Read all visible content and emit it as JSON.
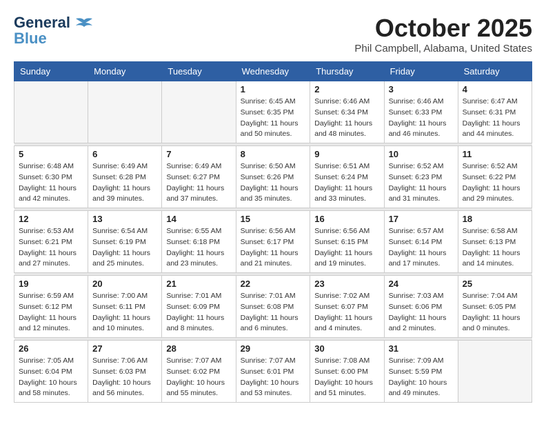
{
  "header": {
    "logo_line1": "General",
    "logo_line2": "Blue",
    "month": "October 2025",
    "location": "Phil Campbell, Alabama, United States"
  },
  "weekdays": [
    "Sunday",
    "Monday",
    "Tuesday",
    "Wednesday",
    "Thursday",
    "Friday",
    "Saturday"
  ],
  "weeks": [
    [
      {
        "day": "",
        "info": ""
      },
      {
        "day": "",
        "info": ""
      },
      {
        "day": "",
        "info": ""
      },
      {
        "day": "1",
        "info": "Sunrise: 6:45 AM\nSunset: 6:35 PM\nDaylight: 11 hours\nand 50 minutes."
      },
      {
        "day": "2",
        "info": "Sunrise: 6:46 AM\nSunset: 6:34 PM\nDaylight: 11 hours\nand 48 minutes."
      },
      {
        "day": "3",
        "info": "Sunrise: 6:46 AM\nSunset: 6:33 PM\nDaylight: 11 hours\nand 46 minutes."
      },
      {
        "day": "4",
        "info": "Sunrise: 6:47 AM\nSunset: 6:31 PM\nDaylight: 11 hours\nand 44 minutes."
      }
    ],
    [
      {
        "day": "5",
        "info": "Sunrise: 6:48 AM\nSunset: 6:30 PM\nDaylight: 11 hours\nand 42 minutes."
      },
      {
        "day": "6",
        "info": "Sunrise: 6:49 AM\nSunset: 6:28 PM\nDaylight: 11 hours\nand 39 minutes."
      },
      {
        "day": "7",
        "info": "Sunrise: 6:49 AM\nSunset: 6:27 PM\nDaylight: 11 hours\nand 37 minutes."
      },
      {
        "day": "8",
        "info": "Sunrise: 6:50 AM\nSunset: 6:26 PM\nDaylight: 11 hours\nand 35 minutes."
      },
      {
        "day": "9",
        "info": "Sunrise: 6:51 AM\nSunset: 6:24 PM\nDaylight: 11 hours\nand 33 minutes."
      },
      {
        "day": "10",
        "info": "Sunrise: 6:52 AM\nSunset: 6:23 PM\nDaylight: 11 hours\nand 31 minutes."
      },
      {
        "day": "11",
        "info": "Sunrise: 6:52 AM\nSunset: 6:22 PM\nDaylight: 11 hours\nand 29 minutes."
      }
    ],
    [
      {
        "day": "12",
        "info": "Sunrise: 6:53 AM\nSunset: 6:21 PM\nDaylight: 11 hours\nand 27 minutes."
      },
      {
        "day": "13",
        "info": "Sunrise: 6:54 AM\nSunset: 6:19 PM\nDaylight: 11 hours\nand 25 minutes."
      },
      {
        "day": "14",
        "info": "Sunrise: 6:55 AM\nSunset: 6:18 PM\nDaylight: 11 hours\nand 23 minutes."
      },
      {
        "day": "15",
        "info": "Sunrise: 6:56 AM\nSunset: 6:17 PM\nDaylight: 11 hours\nand 21 minutes."
      },
      {
        "day": "16",
        "info": "Sunrise: 6:56 AM\nSunset: 6:15 PM\nDaylight: 11 hours\nand 19 minutes."
      },
      {
        "day": "17",
        "info": "Sunrise: 6:57 AM\nSunset: 6:14 PM\nDaylight: 11 hours\nand 17 minutes."
      },
      {
        "day": "18",
        "info": "Sunrise: 6:58 AM\nSunset: 6:13 PM\nDaylight: 11 hours\nand 14 minutes."
      }
    ],
    [
      {
        "day": "19",
        "info": "Sunrise: 6:59 AM\nSunset: 6:12 PM\nDaylight: 11 hours\nand 12 minutes."
      },
      {
        "day": "20",
        "info": "Sunrise: 7:00 AM\nSunset: 6:11 PM\nDaylight: 11 hours\nand 10 minutes."
      },
      {
        "day": "21",
        "info": "Sunrise: 7:01 AM\nSunset: 6:09 PM\nDaylight: 11 hours\nand 8 minutes."
      },
      {
        "day": "22",
        "info": "Sunrise: 7:01 AM\nSunset: 6:08 PM\nDaylight: 11 hours\nand 6 minutes."
      },
      {
        "day": "23",
        "info": "Sunrise: 7:02 AM\nSunset: 6:07 PM\nDaylight: 11 hours\nand 4 minutes."
      },
      {
        "day": "24",
        "info": "Sunrise: 7:03 AM\nSunset: 6:06 PM\nDaylight: 11 hours\nand 2 minutes."
      },
      {
        "day": "25",
        "info": "Sunrise: 7:04 AM\nSunset: 6:05 PM\nDaylight: 11 hours\nand 0 minutes."
      }
    ],
    [
      {
        "day": "26",
        "info": "Sunrise: 7:05 AM\nSunset: 6:04 PM\nDaylight: 10 hours\nand 58 minutes."
      },
      {
        "day": "27",
        "info": "Sunrise: 7:06 AM\nSunset: 6:03 PM\nDaylight: 10 hours\nand 56 minutes."
      },
      {
        "day": "28",
        "info": "Sunrise: 7:07 AM\nSunset: 6:02 PM\nDaylight: 10 hours\nand 55 minutes."
      },
      {
        "day": "29",
        "info": "Sunrise: 7:07 AM\nSunset: 6:01 PM\nDaylight: 10 hours\nand 53 minutes."
      },
      {
        "day": "30",
        "info": "Sunrise: 7:08 AM\nSunset: 6:00 PM\nDaylight: 10 hours\nand 51 minutes."
      },
      {
        "day": "31",
        "info": "Sunrise: 7:09 AM\nSunset: 5:59 PM\nDaylight: 10 hours\nand 49 minutes."
      },
      {
        "day": "",
        "info": ""
      }
    ]
  ]
}
